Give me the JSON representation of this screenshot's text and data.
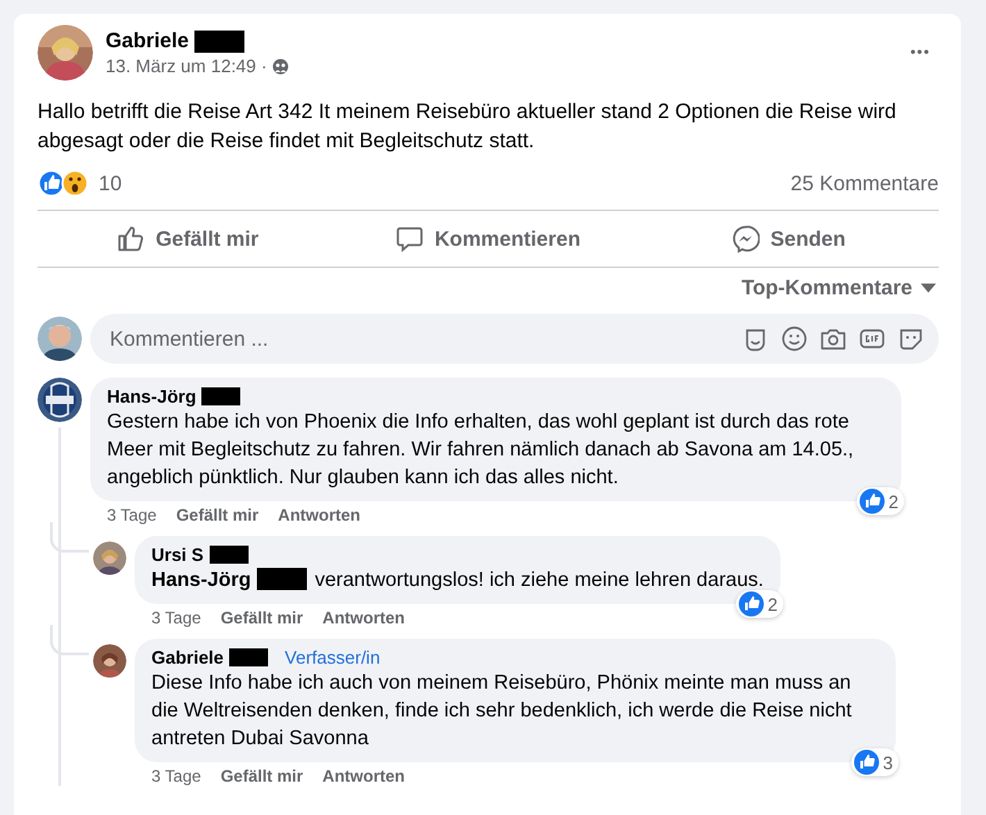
{
  "post": {
    "author": "Gabriele",
    "author_redacted": true,
    "time": "13. März um 12:49 ·",
    "more": "•••",
    "text": "Hallo betrifft die Reise Art 342 It meinem Reisebüro aktueller stand 2 Optionen die Reise wird abgesagt oder die Reise findet mit Begleitschutz statt.",
    "reaction_count": "10",
    "comment_count": "25 Kommentare"
  },
  "actions": [
    {
      "kind": "like",
      "label": "Gefällt mir"
    },
    {
      "kind": "comment",
      "label": "Kommentieren"
    },
    {
      "kind": "send",
      "label": "Senden"
    }
  ],
  "sort_label": "Top-Kommentare",
  "comment_box": {
    "placeholder": "Kommentieren ..."
  },
  "comments": [
    {
      "author": "Hans-Jörg",
      "author_redacted": true,
      "text": "Gestern habe ich von Phoenix die Info erhalten, das wohl geplant ist durch das rote Meer mit Begleitschutz zu fahren. Wir fahren nämlich danach ab Savona am 14.05., angeblich pünktlich. Nur glauben kann ich das alles nicht.",
      "time": "3 Tage",
      "like": "Gefällt mir",
      "reply": "Antworten",
      "reaction_count": "2",
      "replies": [
        {
          "author": "Ursi S",
          "author_redacted": true,
          "mention": "Hans-Jörg",
          "text": "verantwortungslos! ich ziehe meine lehren daraus.",
          "time": "3 Tage",
          "like": "Gefällt mir",
          "reply": "Antworten",
          "reaction_count": "2"
        },
        {
          "author": "Gabriele",
          "author_redacted": true,
          "badge": "Verfasser/in",
          "text": "Diese Info habe ich auch von meinem Reisebüro, Phönix meinte man muss an die Weltreisenden denken, finde ich sehr bedenklich, ich werde die Reise nicht antreten Dubai Savonna",
          "time": "3 Tage",
          "like": "Gefällt mir",
          "reply": "Antworten",
          "reaction_count": "3"
        }
      ]
    }
  ]
}
